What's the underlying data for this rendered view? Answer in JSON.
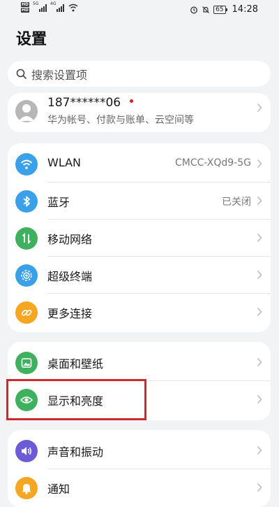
{
  "status_bar": {
    "left_badges": [
      "HD",
      "HD"
    ],
    "signal_labels": [
      "5G",
      "4G"
    ],
    "battery": "65",
    "time": "14:28"
  },
  "page": {
    "title": "设置",
    "search_placeholder": "搜索设置项"
  },
  "account": {
    "name": "187******06",
    "subtitle": "华为帐号、付款与账单、云空间等"
  },
  "groups": [
    [
      {
        "label": "WLAN",
        "value": "CMCC-XQd9-5G",
        "icon": "wifi-icon",
        "color": "#3aa0e8"
      },
      {
        "label": "蓝牙",
        "value": "已关闭",
        "icon": "bluetooth-icon",
        "color": "#3aa0e8"
      },
      {
        "label": "移动网络",
        "value": "",
        "icon": "mobile-network-icon",
        "color": "#3fb05e"
      },
      {
        "label": "超级终端",
        "value": "",
        "icon": "super-device-icon",
        "color": "#3aa0e8"
      },
      {
        "label": "更多连接",
        "value": "",
        "icon": "link-icon",
        "color": "#f5a623"
      }
    ],
    [
      {
        "label": "桌面和壁纸",
        "value": "",
        "icon": "wallpaper-icon",
        "color": "#3fb05e"
      },
      {
        "label": "显示和亮度",
        "value": "",
        "icon": "eye-icon",
        "color": "#3fb05e"
      }
    ],
    [
      {
        "label": "声音和振动",
        "value": "",
        "icon": "speaker-icon",
        "color": "#6b5bd6"
      },
      {
        "label": "通知",
        "value": "",
        "icon": "bell-icon",
        "color": "#f5a623"
      }
    ]
  ],
  "highlight_color": "#d0282c"
}
